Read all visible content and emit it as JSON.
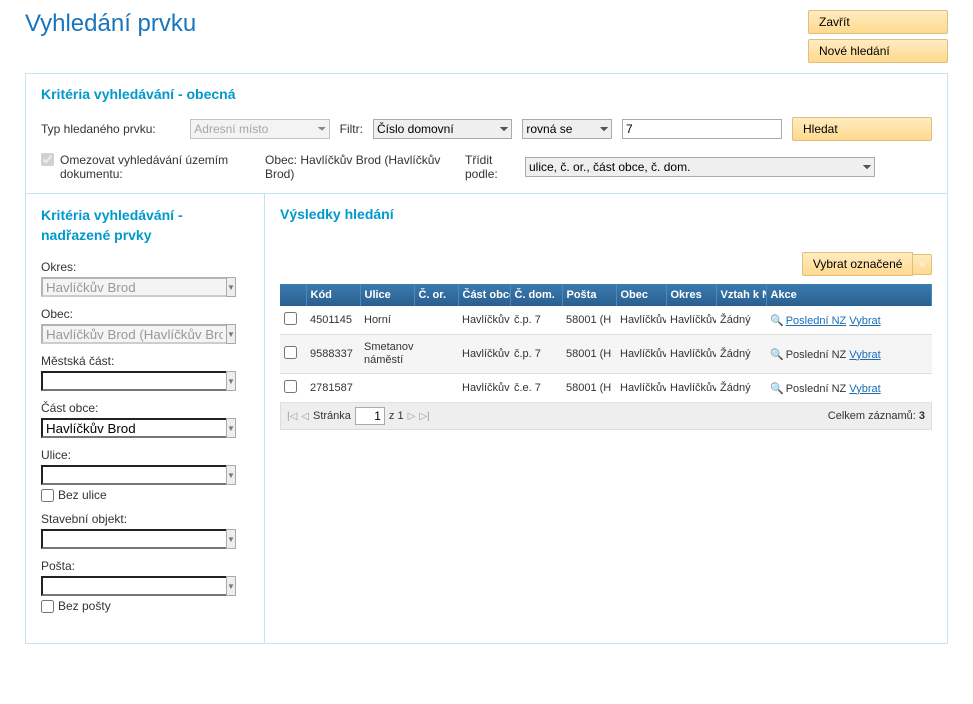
{
  "header": {
    "title": "Vyhledání prvku",
    "close_btn": "Zavřít",
    "new_search_btn": "Nové hledání"
  },
  "criteria_general": {
    "title": "Kritéria vyhledávání - obecná",
    "type_label": "Typ hledaného prvku:",
    "type_value": "Adresní místo",
    "filter_label": "Filtr:",
    "filter_field_value": "Číslo domovní",
    "filter_op_value": "rovná se",
    "filter_text_value": "7",
    "search_btn": "Hledat",
    "limit_label": "Omezovat vyhledávání územím dokumentu:",
    "obec_label": "Obec: Havlíčkův Brod (Havlíčkův Brod)",
    "sort_label": "Třídit podle:",
    "sort_value": "ulice, č. or., část obce, č. dom."
  },
  "criteria_parent": {
    "title": "Kritéria vyhledávání - nadřazené prvky",
    "okres_label": "Okres:",
    "okres_value": "Havlíčkův Brod",
    "obec_label": "Obec:",
    "obec_value": "Havlíčkův Brod (Havlíčkův Brod)",
    "mcast_label": "Městská část:",
    "castobce_label": "Část obce:",
    "castobce_value": "Havlíčkův Brod",
    "ulice_label": "Ulice:",
    "bez_ulice": "Bez ulice",
    "stavobj_label": "Stavební objekt:",
    "posta_label": "Pošta:",
    "bez_posty": "Bez pošty"
  },
  "results": {
    "title": "Výsledky hledání",
    "select_marked_btn": "Vybrat označené",
    "columns": [
      "",
      "Kód",
      "Ulice",
      "Č. or.",
      "Část obce",
      "Č. dom.",
      "Pošta",
      "Obec",
      "Okres",
      "Vztah k NZ",
      "Akce"
    ],
    "rows": [
      {
        "kod": "4501145",
        "ulice": "Horní",
        "cor": "",
        "castobce": "Havlíčkův",
        "cdom": "č.p. 7",
        "posta": "58001 (H",
        "obec": "Havlíčkův",
        "okres": "Havlíčkův",
        "vztah": "Žádný",
        "akce1": "Poslední NZ",
        "akce2": "Vybrat",
        "akce1_link": true
      },
      {
        "kod": "9588337",
        "ulice": "Smetanovo náměstí",
        "cor": "",
        "castobce": "Havlíčkův",
        "cdom": "č.p. 7",
        "posta": "58001 (H",
        "obec": "Havlíčkův",
        "okres": "Havlíčkův",
        "vztah": "Žádný",
        "akce1": "Poslední NZ",
        "akce2": "Vybrat",
        "akce1_link": false
      },
      {
        "kod": "2781587",
        "ulice": "",
        "cor": "",
        "castobce": "Havlíčkův",
        "cdom": "č.e. 7",
        "posta": "58001 (H",
        "obec": "Havlíčkův",
        "okres": "Havlíčkův",
        "vztah": "Žádný",
        "akce1": "Poslední NZ",
        "akce2": "Vybrat",
        "akce1_link": false
      }
    ],
    "pager": {
      "page_label": "Stránka",
      "page_value": "1",
      "total_pages": "z 1",
      "total_records_label": "Celkem záznamů:",
      "total_records": "3"
    }
  }
}
